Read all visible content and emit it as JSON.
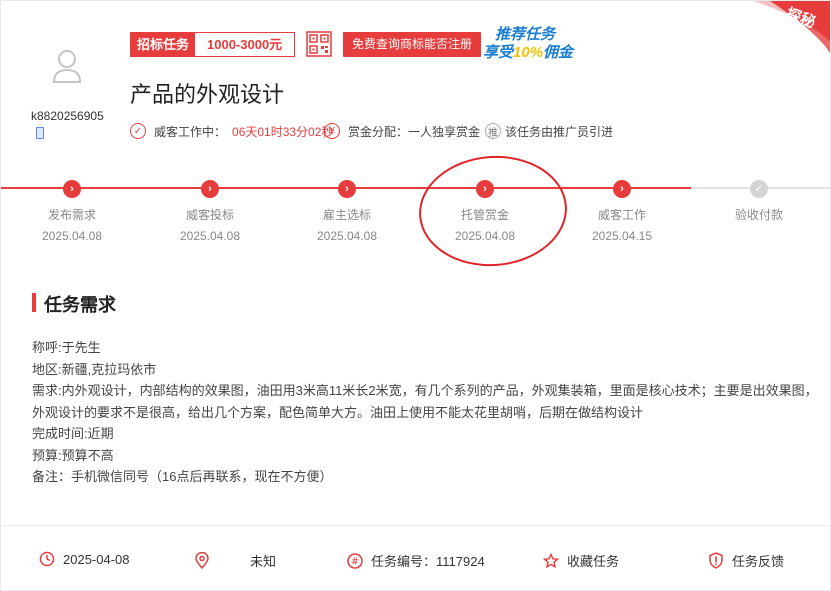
{
  "corner": {
    "label": "探秘",
    "color": "#e63c3c"
  },
  "user": {
    "name": "k8820256905",
    "avatar_icon": "user-icon",
    "phone_icon": "phone-icon"
  },
  "badge": {
    "label": "招标任务",
    "value": "1000-3000元"
  },
  "check_button": {
    "label": "免费查询商标能否注册"
  },
  "promo": {
    "line1": "推荐任务",
    "line2_prefix": "享受",
    "line2_highlight": "10%",
    "line2_suffix": "佣金"
  },
  "title": "产品的外观设计",
  "meta": {
    "status": "威客工作中：",
    "countdown": "06天01时33分02秒",
    "reward": "赏金分配：一人独享赏金",
    "referral_icon_text": "推",
    "referral": "该任务由推广员引进"
  },
  "steps": [
    {
      "label": "发布需求",
      "date": "2025.04.08",
      "done": true
    },
    {
      "label": "威客投标",
      "date": "2025.04.08",
      "done": true
    },
    {
      "label": "雇主选标",
      "date": "2025.04.08",
      "done": true
    },
    {
      "label": "托管赏金",
      "date": "2025.04.08",
      "done": true
    },
    {
      "label": "威客工作",
      "date": "2025.04.15",
      "done": true
    },
    {
      "label": "验收付款",
      "date": "",
      "done": false
    }
  ],
  "requirement": {
    "heading": "任务需求",
    "lines": [
      "称呼:于先生",
      "地区:新疆,克拉玛依市",
      "需求:内外观设计，内部结构的效果图，油田用3米高11米长2米宽，有几个系列的产品，外观集装箱，里面是核心技术；主要是出效果图，",
      "外观设计的要求不是很高，给出几个方案，配色简单大方。油田上使用不能太花里胡哨，后期在做结构设计",
      "完成时间:近期",
      "预算:预算不高",
      "备注：手机微信同号（16点后再联系，现在不方便）"
    ]
  },
  "footer": {
    "date": "2025-04-08",
    "location": "未知",
    "task_no": "任务编号：1117924",
    "favorite": "收藏任务",
    "feedback": "任务反馈"
  },
  "colors": {
    "accent": "#e63c3c",
    "pending": "#d4d4d4",
    "promo": "#1b7ed0"
  }
}
